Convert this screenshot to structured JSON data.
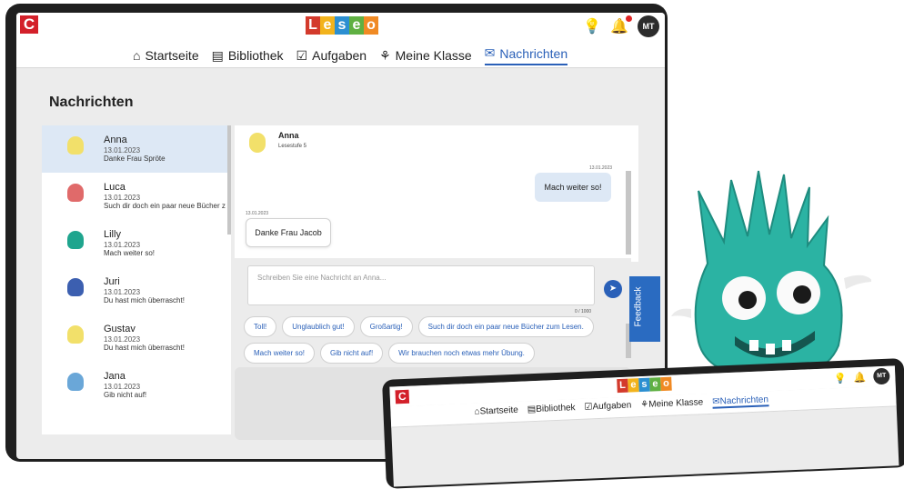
{
  "app": {
    "logo_letter": "C",
    "brand_letters": [
      "L",
      "e",
      "s",
      "e",
      "o"
    ],
    "brand_colors": [
      "#d33a2c",
      "#f2b31c",
      "#2c8fd1",
      "#5fb042",
      "#f08a24"
    ],
    "avatar_initials": "MT"
  },
  "nav": {
    "items": [
      {
        "icon": "home-icon",
        "glyph": "⌂",
        "label": "Startseite"
      },
      {
        "icon": "library-icon",
        "glyph": "▤",
        "label": "Bibliothek"
      },
      {
        "icon": "tasks-icon",
        "glyph": "☑",
        "label": "Aufgaben"
      },
      {
        "icon": "class-icon",
        "glyph": "⚘",
        "label": "Meine Klasse"
      },
      {
        "icon": "messages-icon",
        "glyph": "✉",
        "label": "Nachrichten"
      }
    ],
    "active": "Nachrichten"
  },
  "page": {
    "title": "Nachrichten"
  },
  "conversations": [
    {
      "name": "Anna",
      "date": "13.01.2023",
      "preview": "Danke Frau Spröte",
      "color": "#f2e06a",
      "selected": true
    },
    {
      "name": "Luca",
      "date": "13.01.2023",
      "preview": "Such dir doch ein paar neue Bücher z",
      "color": "#e06a6a"
    },
    {
      "name": "Lilly",
      "date": "13.01.2023",
      "preview": "Mach weiter so!",
      "color": "#1fa58e"
    },
    {
      "name": "Juri",
      "date": "13.01.2023",
      "preview": "Du hast mich überrascht!",
      "color": "#3c5fb0"
    },
    {
      "name": "Gustav",
      "date": "13.01.2023",
      "preview": "Du hast mich überrascht!",
      "color": "#f2e06a"
    },
    {
      "name": "Jana",
      "date": "13.01.2023",
      "preview": "Gib nicht auf!",
      "color": "#6aa7d8"
    }
  ],
  "chat": {
    "name": "Anna",
    "level": "Lesestufe 5",
    "messages": [
      {
        "direction": "outgoing",
        "date": "13.01.2023",
        "text": "Mach weiter so!"
      },
      {
        "direction": "incoming",
        "date": "13.01.2023",
        "text": "Danke Frau Jacob"
      }
    ],
    "input_placeholder": "Schreiben Sie eine Nachricht an Anna...",
    "counter": "0 / 1000",
    "quick_replies": [
      "Toll!",
      "Unglaublich gut!",
      "Großartig!",
      "Such dir doch ein paar neue Bücher zum Lesen.",
      "Mach weiter so!",
      "Gib nicht auf!",
      "Wir brauchen noch etwas mehr Übung."
    ]
  },
  "feedback_label": "Feedback",
  "colors": {
    "accent": "#2a60b8",
    "feedback": "#2a6bc1",
    "selected_row": "#dde8f5",
    "mascot": "#2bb3a3"
  }
}
